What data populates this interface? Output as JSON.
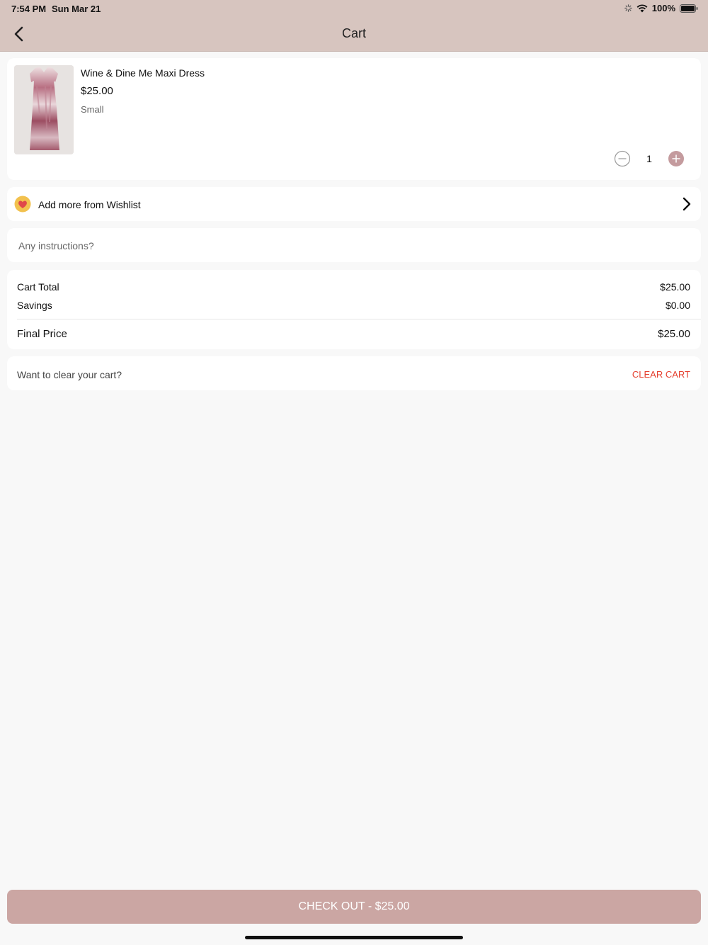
{
  "status_bar": {
    "time": "7:54 PM",
    "date": "Sun Mar 21",
    "battery": "100%",
    "icons": [
      "loading-indicator-icon",
      "wifi-icon",
      "battery-icon"
    ]
  },
  "header": {
    "title": "Cart",
    "back_icon": "chevron-left-icon"
  },
  "cart_item": {
    "name": "Wine & Dine Me Maxi Dress",
    "price": "$25.00",
    "size": "Small",
    "quantity": "1",
    "minus_icon": "minus-circle-icon",
    "plus_icon": "plus-circle-icon"
  },
  "wishlist": {
    "label": "Add more from Wishlist",
    "icon": "heart-icon",
    "chevron_icon": "chevron-right-icon"
  },
  "instructions": {
    "placeholder": "Any instructions?",
    "value": ""
  },
  "totals": {
    "cart_total_label": "Cart Total",
    "cart_total_value": "$25.00",
    "savings_label": "Savings",
    "savings_value": "$0.00",
    "final_label": "Final Price",
    "final_value": "$25.00"
  },
  "clear": {
    "question": "Want to clear your cart?",
    "button": "CLEAR CART"
  },
  "checkout": {
    "label": "CHECK OUT - $25.00"
  },
  "colors": {
    "header_bg": "#d7c5bf",
    "accent": "#cba6a3",
    "clear_red": "#e5402f",
    "page_bg": "#f8f8f8"
  }
}
